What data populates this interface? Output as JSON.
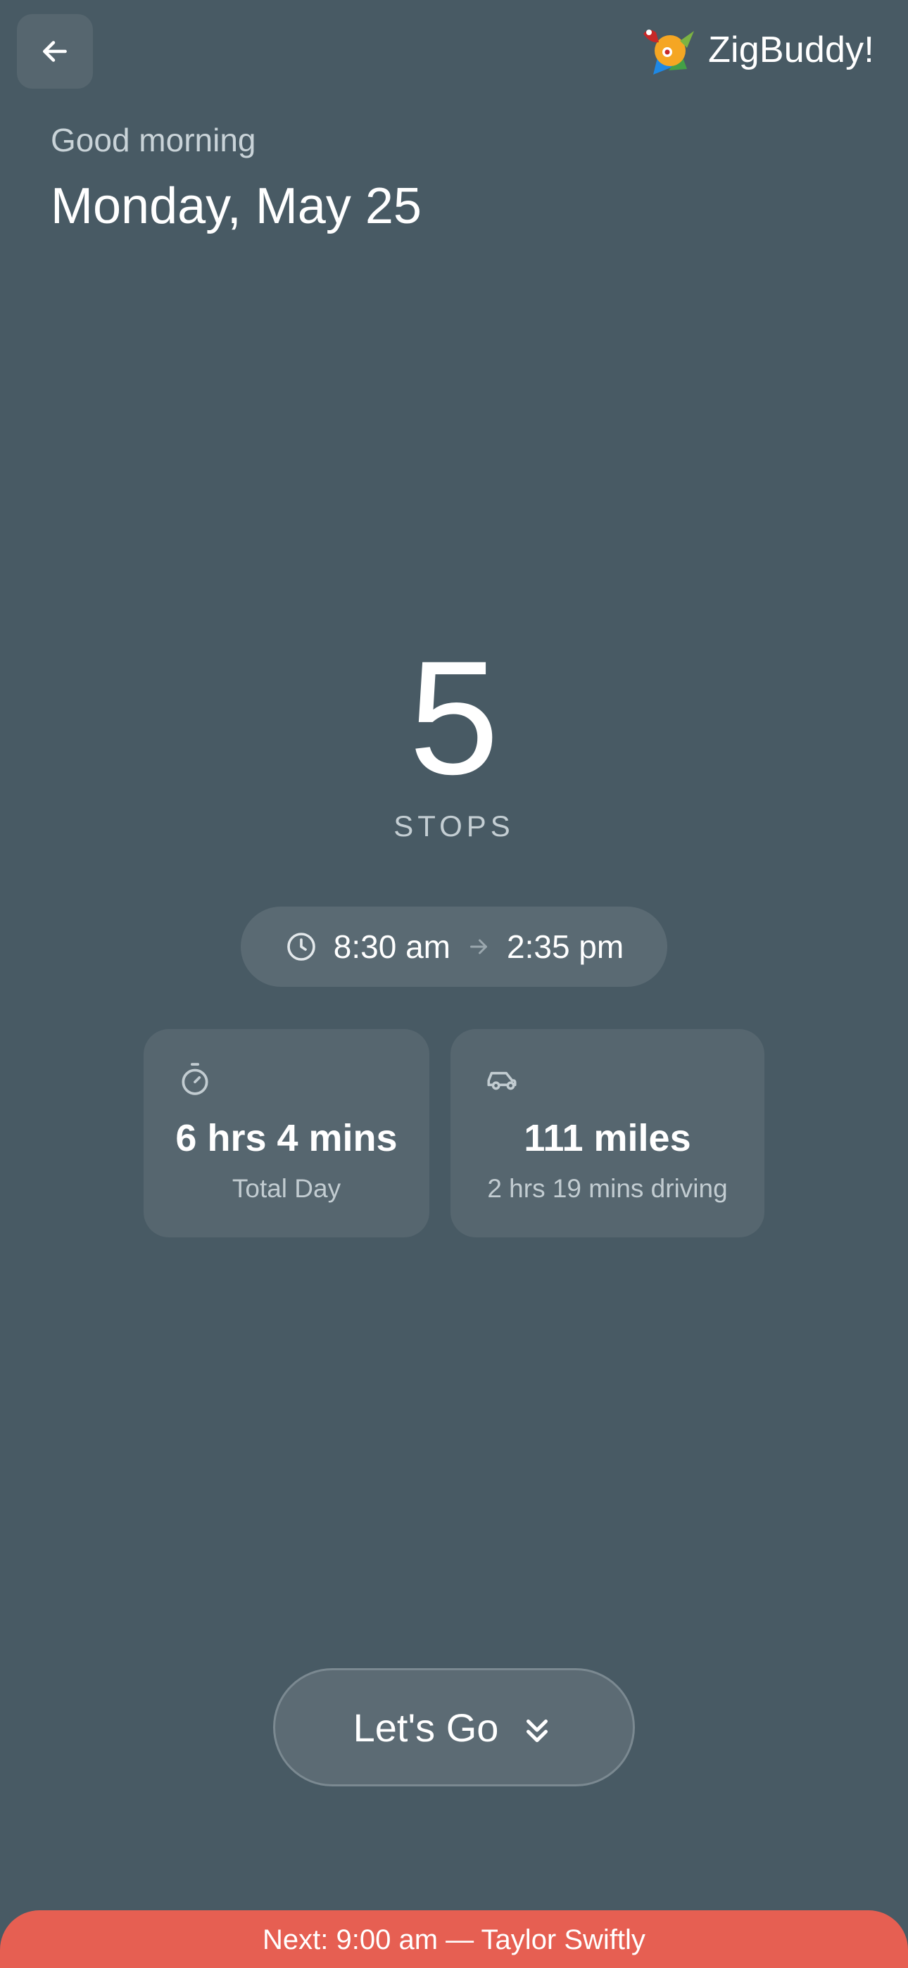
{
  "header": {
    "back_icon": "arrow-left-icon",
    "brand": {
      "logo_icon": "bird-logo-icon",
      "name": "ZigBuddy!"
    }
  },
  "greeting": {
    "salutation": "Good morning",
    "date": "Monday, May 25"
  },
  "summary": {
    "stops_count": "5",
    "stops_label": "STOPS",
    "time_range": {
      "clock_icon": "clock-icon",
      "start": "8:30 am",
      "arrow_icon": "arrow-right-icon",
      "end": "2:35 pm"
    }
  },
  "stats": [
    {
      "icon": "stopwatch-icon",
      "value": "6 hrs 4 mins",
      "label": "Total Day"
    },
    {
      "icon": "car-icon",
      "value": "111 miles",
      "label": "2 hrs 19 mins driving"
    }
  ],
  "actions": {
    "go_label": "Let's Go",
    "go_icon": "double-chevron-down-icon"
  },
  "next_bar": {
    "text": "Next: 9:00 am — Taylor Swiftly"
  },
  "colors": {
    "background": "#485a64",
    "card": "#56666f",
    "accent_next": "#e65f52",
    "text_primary": "#ffffff",
    "text_secondary": "#c4ced3"
  }
}
